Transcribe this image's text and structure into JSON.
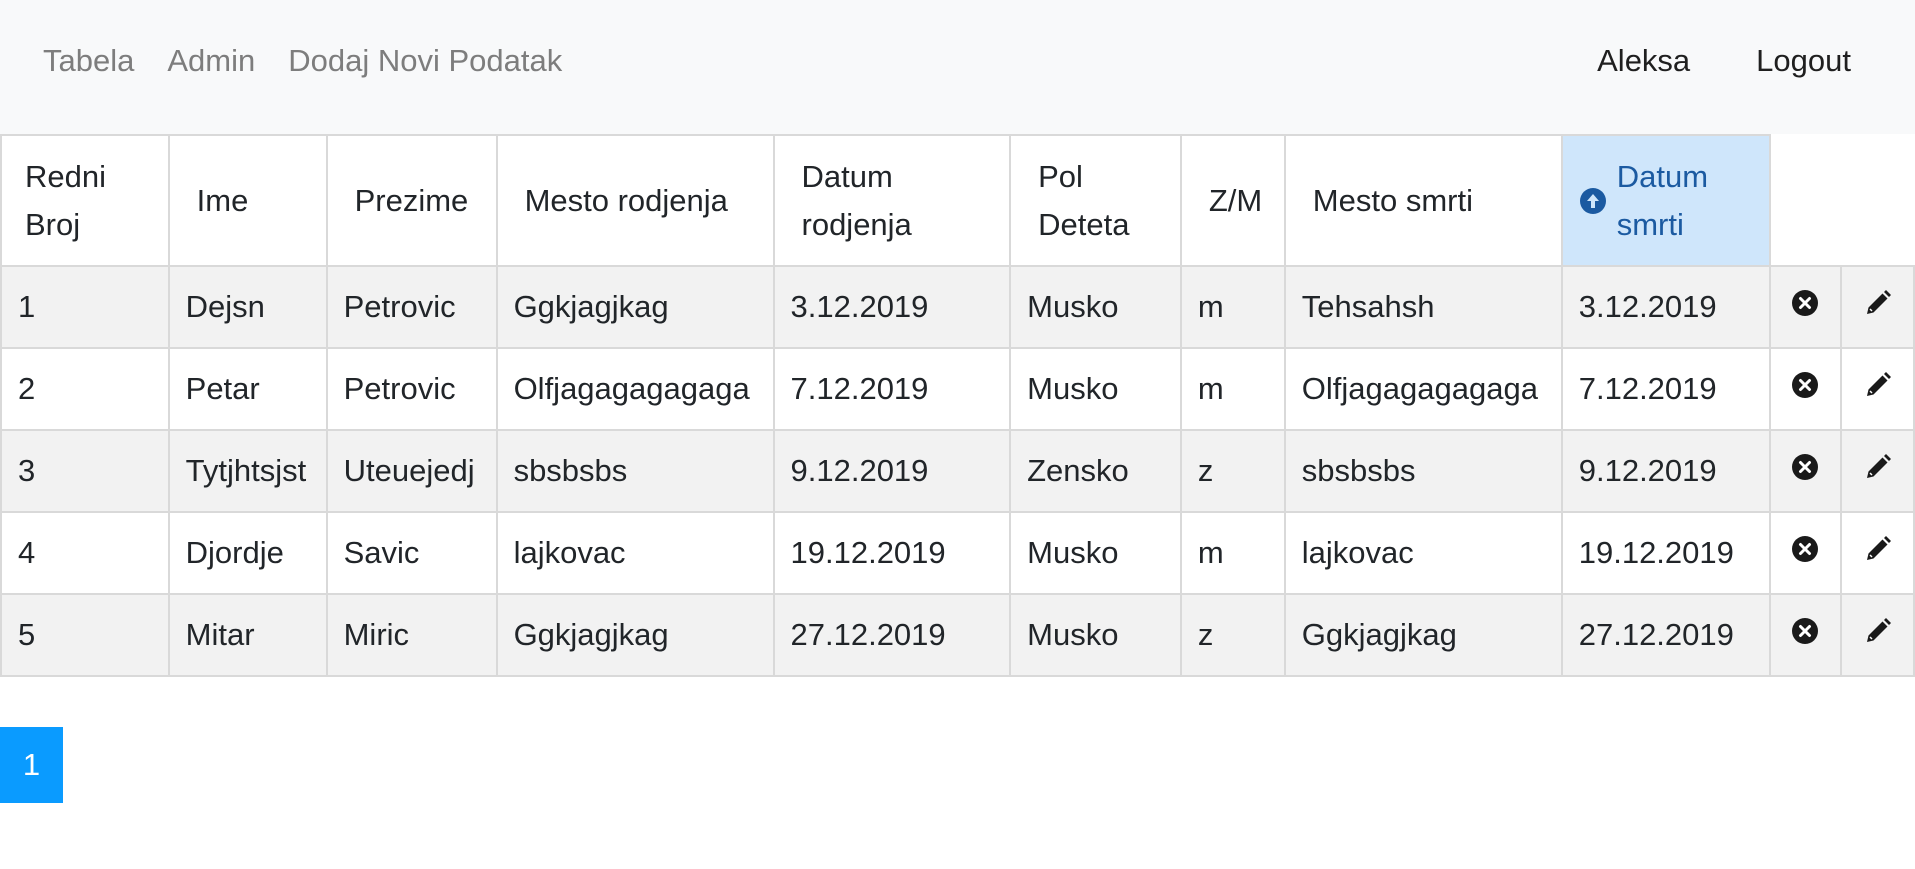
{
  "nav": {
    "left": [
      "Tabela",
      "Admin",
      "Dodaj Novi Podatak"
    ],
    "user": "Aleksa",
    "logout": "Logout"
  },
  "table": {
    "headers": [
      "Redni Broj",
      "Ime",
      "Prezime",
      "Mesto rodjenja",
      "Datum rodjenja",
      "Pol Deteta",
      "Z/M",
      "Mesto smrti",
      "Datum smrti"
    ],
    "sorted_column": "Datum smrti",
    "sort_direction": "ascending",
    "rows": [
      [
        "1",
        "Dejsn",
        "Petrovic",
        "Ggkjagjkag",
        "3.12.2019",
        "Musko",
        "m",
        "Tehsahsh",
        "3.12.2019"
      ],
      [
        "2",
        "Petar",
        "Petrovic",
        "Olfjagagagagaga",
        "7.12.2019",
        "Musko",
        "m",
        "Olfjagagagagaga",
        "7.12.2019"
      ],
      [
        "3",
        "Tytjhtsjst",
        "Uteuejedj",
        "sbsbsbs",
        "9.12.2019",
        "Zensko",
        "z",
        "sbsbsbs",
        "9.12.2019"
      ],
      [
        "4",
        "Djordje",
        "Savic",
        "lajkovac",
        "19.12.2019",
        "Musko",
        "m",
        "lajkovac",
        "19.12.2019"
      ],
      [
        "5",
        "Mitar",
        "Miric",
        "Ggkjagjkag",
        "27.12.2019",
        "Musko",
        "z",
        "Ggkjagjkag",
        "27.12.2019"
      ]
    ],
    "row_actions": [
      "delete-icon",
      "edit-icon"
    ]
  },
  "pagination": {
    "current_page": "1"
  },
  "colors": {
    "navbar_bg": "#f8f9fa",
    "sorted_header_bg": "#cfe6fb",
    "sorted_header_text": "#1b5aa1",
    "striped_row_bg": "#f2f2f2",
    "pager_bg": "#0a9bff"
  }
}
